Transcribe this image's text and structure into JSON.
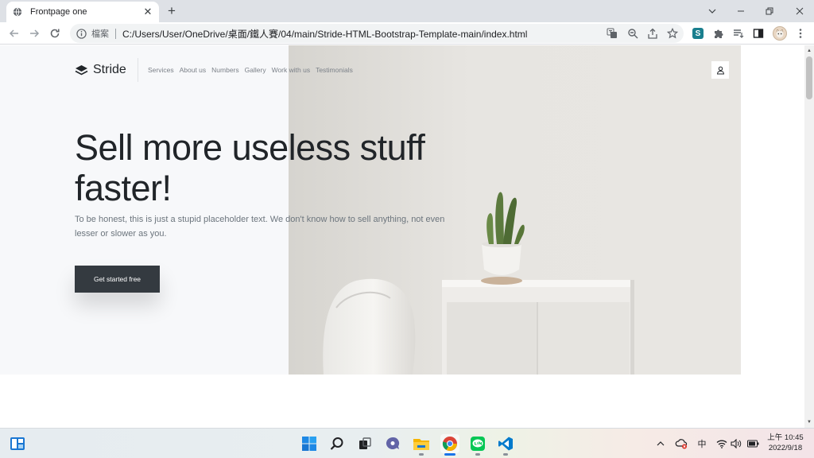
{
  "browser": {
    "tab_title": "Frontpage one",
    "url_scheme_label": "檔案",
    "url": "C:/Users/User/OneDrive/桌面/鐵人賽/04/main/Stride-HTML-Bootstrap-Template-main/index.html",
    "extension_badge": "S"
  },
  "site": {
    "brand": "Stride",
    "nav": [
      "Services",
      "About us",
      "Numbers",
      "Gallery",
      "Work with us",
      "Testimonials"
    ],
    "headline": "Sell more useless stuff faster!",
    "subtext": "To be honest, this is just a stupid placeholder text. We don't know how to sell anything, not even lesser or slower as you.",
    "cta_label": "Get started free"
  },
  "taskbar": {
    "ime": "中",
    "clock_time": "上午 10:45",
    "clock_date": "2022/9/18"
  }
}
